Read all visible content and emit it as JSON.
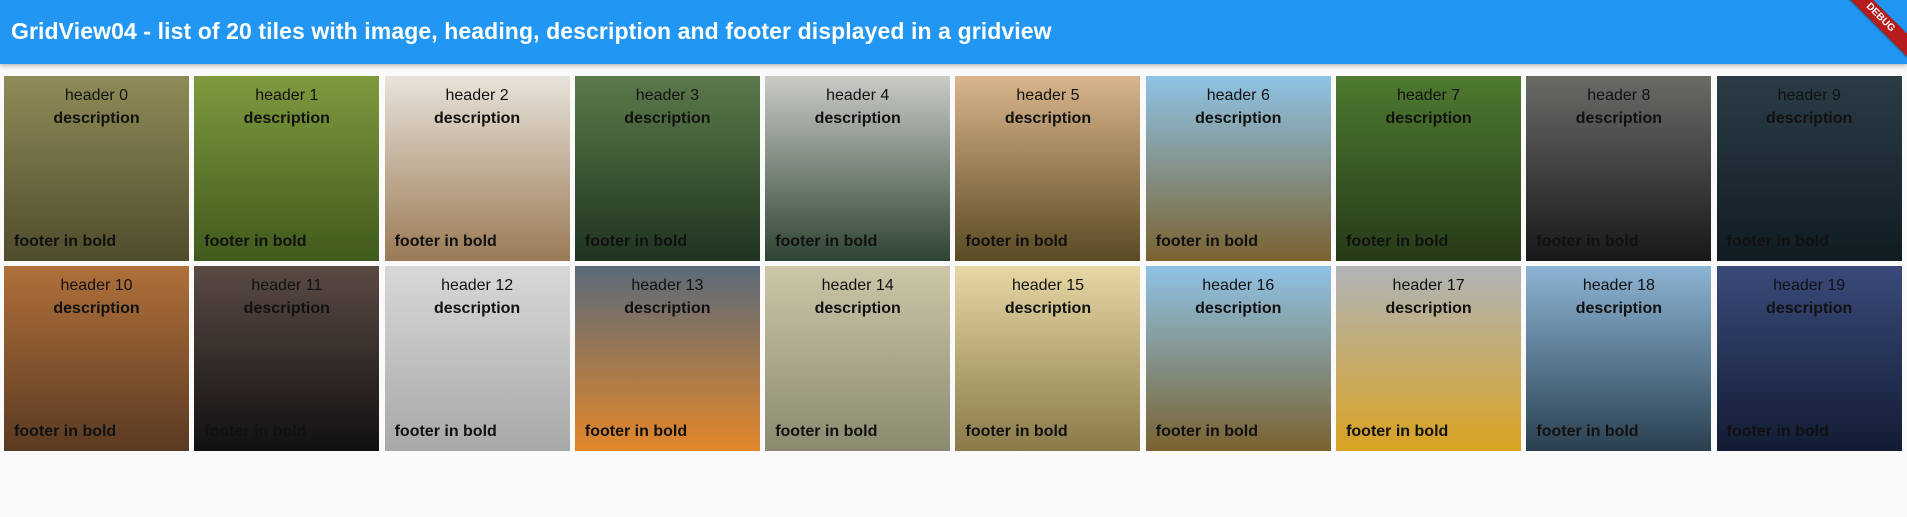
{
  "appbar": {
    "title": "GridView04 - list of 20 tiles with image, heading, description and footer displayed in a gridview",
    "color": "#2196f3"
  },
  "debug_banner": "DEBUG",
  "tiles": [
    {
      "header": "header 0",
      "description": "description",
      "footer": "footer in bold",
      "image": "guitar-headstock",
      "colors": [
        "#8f8b58",
        "#4f4c2c"
      ]
    },
    {
      "header": "header 1",
      "description": "description",
      "footer": "footer in bold",
      "image": "tennis-court",
      "colors": [
        "#7f9a3e",
        "#3f5a1c"
      ]
    },
    {
      "header": "header 2",
      "description": "description",
      "footer": "footer in bold",
      "image": "hand-phone-desk",
      "colors": [
        "#e8e3da",
        "#9a7a55"
      ]
    },
    {
      "header": "header 3",
      "description": "description",
      "footer": "footer in bold",
      "image": "forest-escalator",
      "colors": [
        "#5b7a4a",
        "#1f3320"
      ]
    },
    {
      "header": "header 4",
      "description": "description",
      "footer": "footer in bold",
      "image": "misty-forest",
      "colors": [
        "#c9cbc6",
        "#2e4433"
      ]
    },
    {
      "header": "header 5",
      "description": "description",
      "footer": "footer in bold",
      "image": "cactus-sunset",
      "colors": [
        "#d9b58c",
        "#5a4a22"
      ]
    },
    {
      "header": "header 6",
      "description": "description",
      "footer": "footer in bold",
      "image": "lake-swing-chair",
      "colors": [
        "#8ec3e6",
        "#7a6230"
      ]
    },
    {
      "header": "header 7",
      "description": "description",
      "footer": "footer in bold",
      "image": "railway-tracks",
      "colors": [
        "#4e7a30",
        "#263a18"
      ]
    },
    {
      "header": "header 8",
      "description": "description",
      "footer": "footer in bold",
      "image": "light-ring",
      "colors": [
        "#6a6a66",
        "#18181a"
      ]
    },
    {
      "header": "header 9",
      "description": "description",
      "footer": "footer in bold",
      "image": "night-sky-trees",
      "colors": [
        "#2b3c47",
        "#101c22"
      ]
    },
    {
      "header": "header 10",
      "description": "description",
      "footer": "footer in bold",
      "image": "cobblestone-alley",
      "colors": [
        "#b0703a",
        "#5a3a22"
      ]
    },
    {
      "header": "header 11",
      "description": "description",
      "footer": "footer in bold",
      "image": "vintage-camera",
      "colors": [
        "#5a4a44",
        "#121010"
      ]
    },
    {
      "header": "header 12",
      "description": "description",
      "footer": "footer in bold",
      "image": "surfer-beach",
      "colors": [
        "#d8d8d8",
        "#a8a8a8"
      ]
    },
    {
      "header": "header 13",
      "description": "description",
      "footer": "footer in bold",
      "image": "sunset-hills",
      "colors": [
        "#5a6a7a",
        "#e3862a"
      ]
    },
    {
      "header": "header 14",
      "description": "description",
      "footer": "footer in bold",
      "image": "foggy-figure",
      "colors": [
        "#cdc6a8",
        "#8a8a70"
      ]
    },
    {
      "header": "header 15",
      "description": "description",
      "footer": "footer in bold",
      "image": "golden-fog-lake",
      "colors": [
        "#e6d7a4",
        "#8a7a4a"
      ]
    },
    {
      "header": "header 16",
      "description": "description",
      "footer": "footer in bold",
      "image": "lake-swing-chair",
      "colors": [
        "#8ec3e6",
        "#7a6230"
      ]
    },
    {
      "header": "header 17",
      "description": "description",
      "footer": "footer in bold",
      "image": "city-taxis",
      "colors": [
        "#b0b4b8",
        "#d9a321"
      ]
    },
    {
      "header": "header 18",
      "description": "description",
      "footer": "footer in bold",
      "image": "ocean-sky",
      "colors": [
        "#8cb4d4",
        "#2a4050"
      ]
    },
    {
      "header": "header 19",
      "description": "description",
      "footer": "footer in bold",
      "image": "bridge-night",
      "colors": [
        "#3a4a7a",
        "#121c34"
      ]
    }
  ]
}
